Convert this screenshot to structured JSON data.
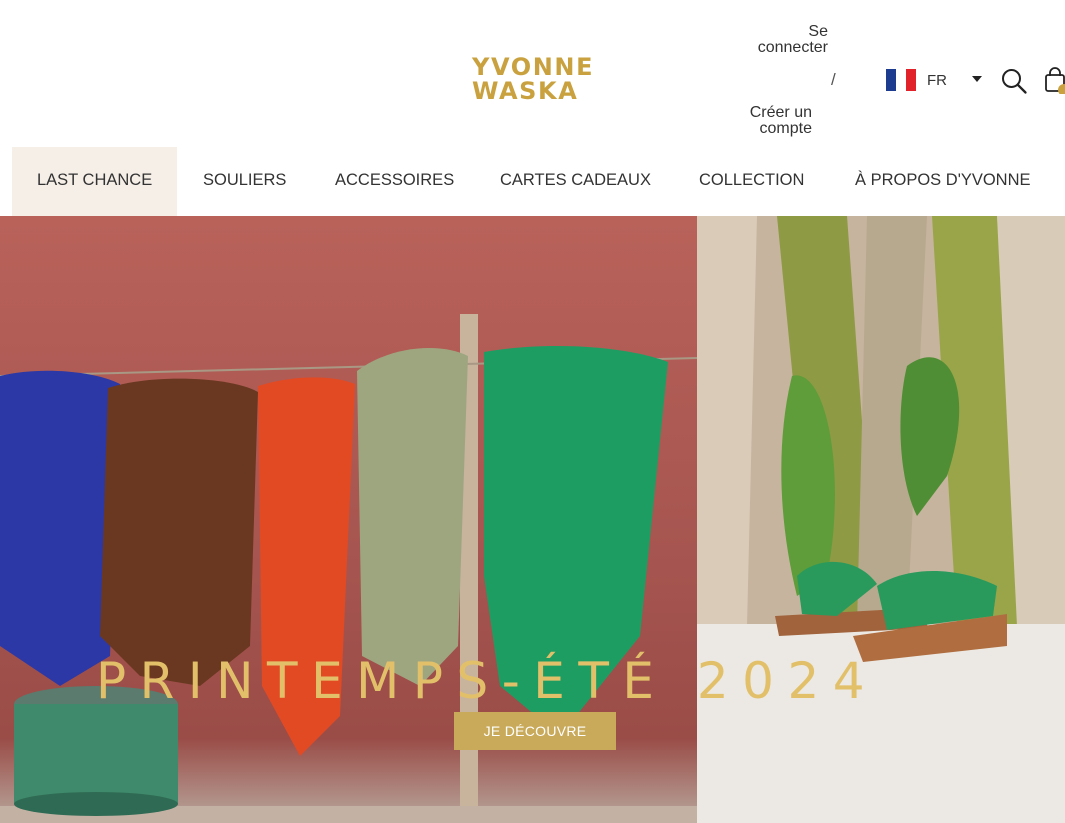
{
  "brand": {
    "logo_line1": "YVONNE",
    "logo_line2": "WASKA",
    "color": "#c9a23f"
  },
  "account": {
    "login_label": "Se connecter",
    "separator": "/",
    "signup_label": "Créer un compte"
  },
  "language": {
    "code": "FR",
    "flag_colors": [
      "#1d3c8f",
      "#ffffff",
      "#e1222b"
    ]
  },
  "icons": {
    "search": "search-icon",
    "cart": "cart-icon",
    "dropdown": "chevron-down-icon"
  },
  "nav": {
    "items": [
      {
        "label": "LAST CHANCE",
        "active": true
      },
      {
        "label": "SOULIERS"
      },
      {
        "label": "ACCESSOIRES"
      },
      {
        "label": "CARTES CADEAUX"
      },
      {
        "label": "COLLECTION"
      },
      {
        "label": "À PROPOS D'YVONNE"
      }
    ]
  },
  "hero": {
    "title": "PRINTEMPS-ÉTÉ 2024",
    "cta_label": "JE DÉCOUVRE",
    "cta_color": "#c9a95a"
  }
}
